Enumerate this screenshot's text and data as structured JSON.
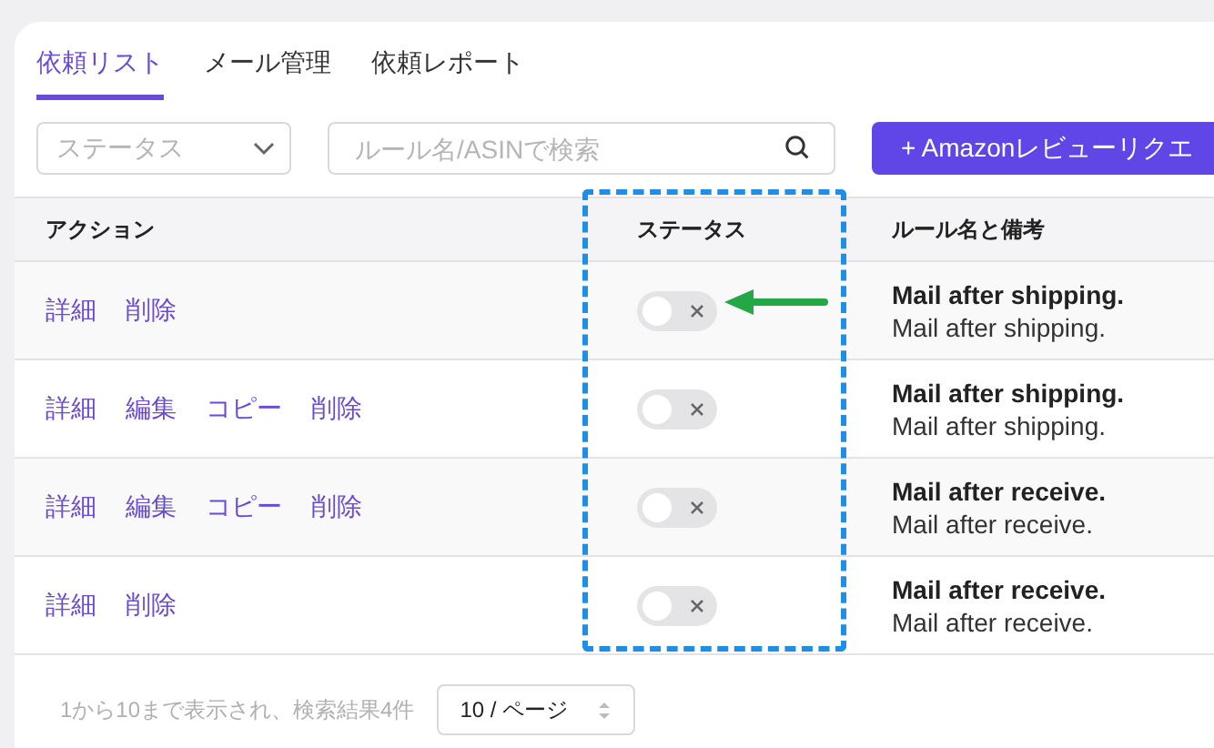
{
  "tabs": [
    {
      "label": "依頼リスト",
      "selected": true
    },
    {
      "label": "メール管理",
      "selected": false
    },
    {
      "label": "依頼レポート",
      "selected": false
    }
  ],
  "filters": {
    "status_select": {
      "placeholder": "ステータス"
    },
    "search": {
      "placeholder": "ルール名/ASINで検索"
    },
    "add_button": "+ Amazonレビューリクエ"
  },
  "table": {
    "columns": [
      "アクション",
      "ステータス",
      "ルール名と備考"
    ],
    "rows": [
      {
        "actions": [
          "詳細",
          "削除"
        ],
        "on": false,
        "title": "Mail after shipping.",
        "note": "Mail after shipping."
      },
      {
        "actions": [
          "詳細",
          "編集",
          "コピー",
          "削除"
        ],
        "on": false,
        "title": "Mail after shipping.",
        "note": "Mail after shipping."
      },
      {
        "actions": [
          "詳細",
          "編集",
          "コピー",
          "削除"
        ],
        "on": false,
        "title": "Mail after receive.",
        "note": "Mail after receive."
      },
      {
        "actions": [
          "詳細",
          "削除"
        ],
        "on": false,
        "title": "Mail after receive.",
        "note": "Mail after receive."
      }
    ]
  },
  "pagination": {
    "summary": "1から10まで表示され、検索結果4件",
    "page_size": "10 / ページ"
  }
}
